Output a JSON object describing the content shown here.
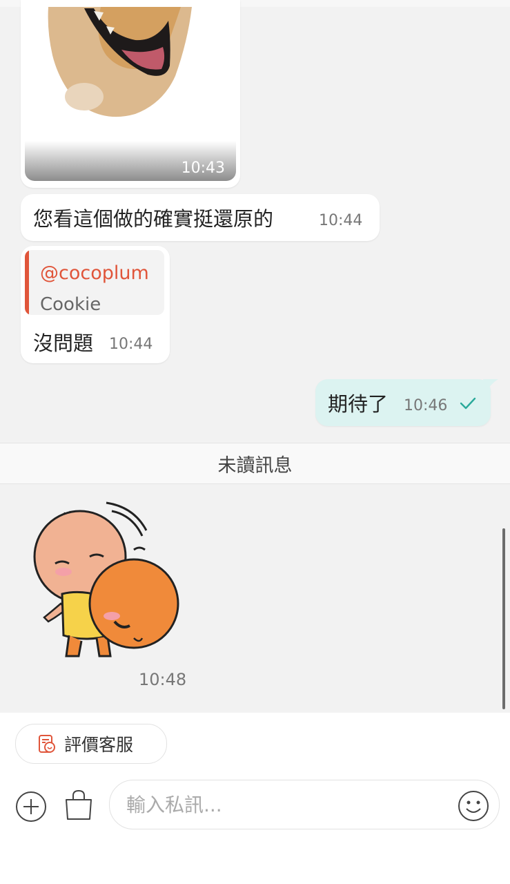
{
  "messages": [
    {
      "type": "image",
      "time": "10:43"
    },
    {
      "type": "text",
      "text": "您看這個做的確實挺還原的",
      "time": "10:44"
    },
    {
      "type": "reply",
      "quote_user": "@cocoplum",
      "quote_text": "Cookie",
      "text": "沒問題",
      "time": "10:44"
    }
  ],
  "sent_message": {
    "text": "期待了",
    "time": "10:46",
    "status_icon": "check-icon"
  },
  "unread_divider": "未讀訊息",
  "sticker_message": {
    "time": "10:48"
  },
  "rate_button": {
    "label": "評價客服",
    "icon": "rating-icon"
  },
  "composer": {
    "placeholder": "輸入私訊...",
    "add_icon": "plus-circle-icon",
    "shop_icon": "shopping-bag-icon",
    "emoji_icon": "smiley-icon"
  },
  "colors": {
    "accent": "#e0553a",
    "sent_bubble": "#dcf3f1",
    "check": "#2aa99a"
  }
}
